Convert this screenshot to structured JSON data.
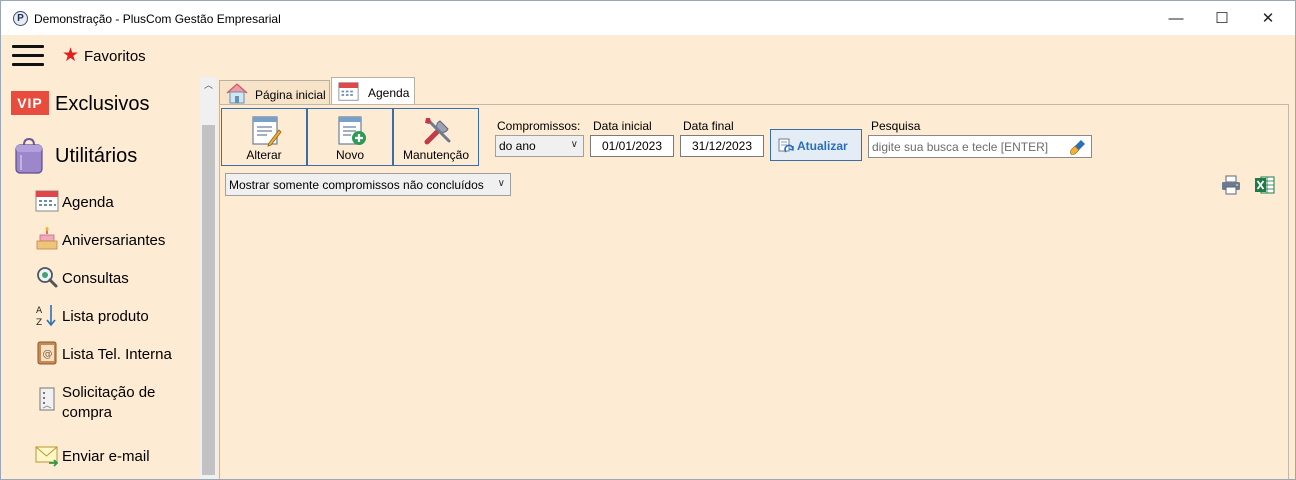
{
  "window": {
    "title": "Demonstração - PlusCom Gestão Empresarial",
    "app_icon_letter": "P",
    "controls": {
      "minimize": "—",
      "maximize": "☐",
      "close": "✕"
    }
  },
  "topbar": {
    "favorites_label": "Favoritos"
  },
  "sidebar": {
    "vip_badge": "VIP",
    "exclusive_label": "Exclusivos",
    "utilities_label": "Utilitários",
    "items": [
      {
        "label": "Agenda",
        "icon": "calendar-icon"
      },
      {
        "label": "Aniversariantes",
        "icon": "cake-icon"
      },
      {
        "label": "Consultas",
        "icon": "magnifier-icon"
      },
      {
        "label": "Lista produto",
        "icon": "sort-az-icon"
      },
      {
        "label": "Lista Tel. Interna",
        "icon": "address-book-icon"
      },
      {
        "label": "Solicitação de compra",
        "icon": "notepad-icon"
      },
      {
        "label": "Enviar e-mail",
        "icon": "email-icon"
      }
    ]
  },
  "tabs": [
    {
      "label": "Página inicial",
      "icon": "home-icon",
      "active": false
    },
    {
      "label": "Agenda",
      "icon": "calendar-icon",
      "active": true
    }
  ],
  "toolbar": {
    "edit_label": "Alterar",
    "new_label": "Novo",
    "maintenance_label": "Manutenção"
  },
  "filters": {
    "appointments_label": "Compromissos:",
    "appointments_value": "do ano",
    "start_date_label": "Data inicial",
    "start_date_value": "01/01/2023",
    "end_date_label": "Data final",
    "end_date_value": "31/12/2023",
    "refresh_label": "Atualizar",
    "search_label": "Pesquisa",
    "search_placeholder": "digite sua busca e tecle [ENTER]",
    "show_filter_value": "Mostrar somente compromissos não concluídos"
  },
  "colors": {
    "background": "#fdebd3",
    "accent_blue": "#2a6fba",
    "vip_red": "#e74c3c",
    "star_red": "#e02020",
    "excel_green": "#1e7b45"
  }
}
